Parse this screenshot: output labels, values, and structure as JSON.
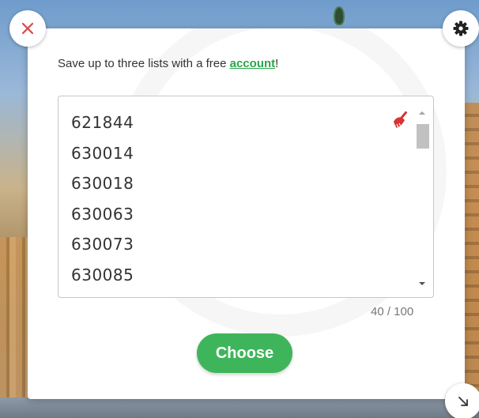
{
  "promo": {
    "text_before": "Save up to three lists with a free ",
    "link_text": "account",
    "text_after": "!"
  },
  "list": {
    "items": [
      "621844",
      "630014",
      "630018",
      "630063",
      "630073",
      "630085"
    ]
  },
  "counter": "40 / 100",
  "choose_label": "Choose",
  "icons": {
    "close": "close-icon",
    "settings": "gear-icon",
    "resize": "resize-arrow-icon",
    "clear": "broom-icon"
  },
  "colors": {
    "accent_green": "#3fb55b",
    "link_green": "#2aa54b",
    "close_red": "#e04444",
    "clear_red": "#d93333"
  }
}
